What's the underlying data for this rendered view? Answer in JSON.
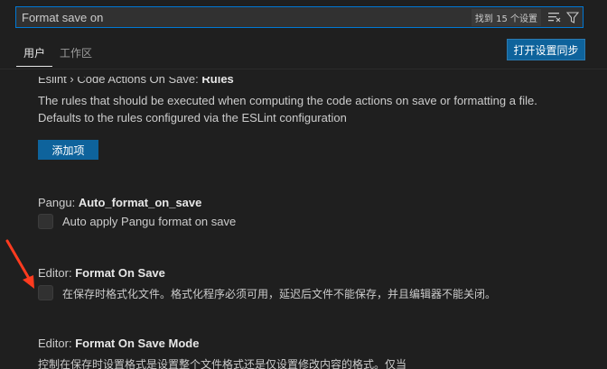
{
  "search": {
    "value": "Format save on",
    "result_count": "找到 15 个设置",
    "icons": [
      "clear-filter-icon",
      "filter-icon"
    ]
  },
  "tabs": [
    {
      "label": "用户",
      "active": true
    },
    {
      "label": "工作区",
      "active": false
    }
  ],
  "sync_button": "打开设置同步",
  "settings": {
    "eslint": {
      "category": "Eslint › Code Actions On Save: ",
      "name": "Rules",
      "desc_line1": "The rules that should be executed when computing the code actions on save or formatting a file.",
      "desc_line2": "Defaults to the rules configured via the ESLint configuration",
      "add_button": "添加项"
    },
    "pangu": {
      "category": "Pangu: ",
      "name": "Auto_format_on_save",
      "desc": "Auto apply Pangu format on save",
      "checked": false
    },
    "format_on_save": {
      "category": "Editor: ",
      "name": "Format On Save",
      "desc": "在保存时格式化文件。格式化程序必须可用，延迟后文件不能保存，并且编辑器不能关闭。",
      "checked": false
    },
    "format_on_save_mode": {
      "category": "Editor: ",
      "name": "Format On Save Mode",
      "desc": "控制在保存时设置格式是设置整个文件格式还是仅设置修改内容的格式。仅当"
    }
  },
  "colors": {
    "background": "#1f1f1f",
    "accent": "#0e639c",
    "focus_border": "#0078d4",
    "annotation_arrow": "#ff3b1f"
  }
}
